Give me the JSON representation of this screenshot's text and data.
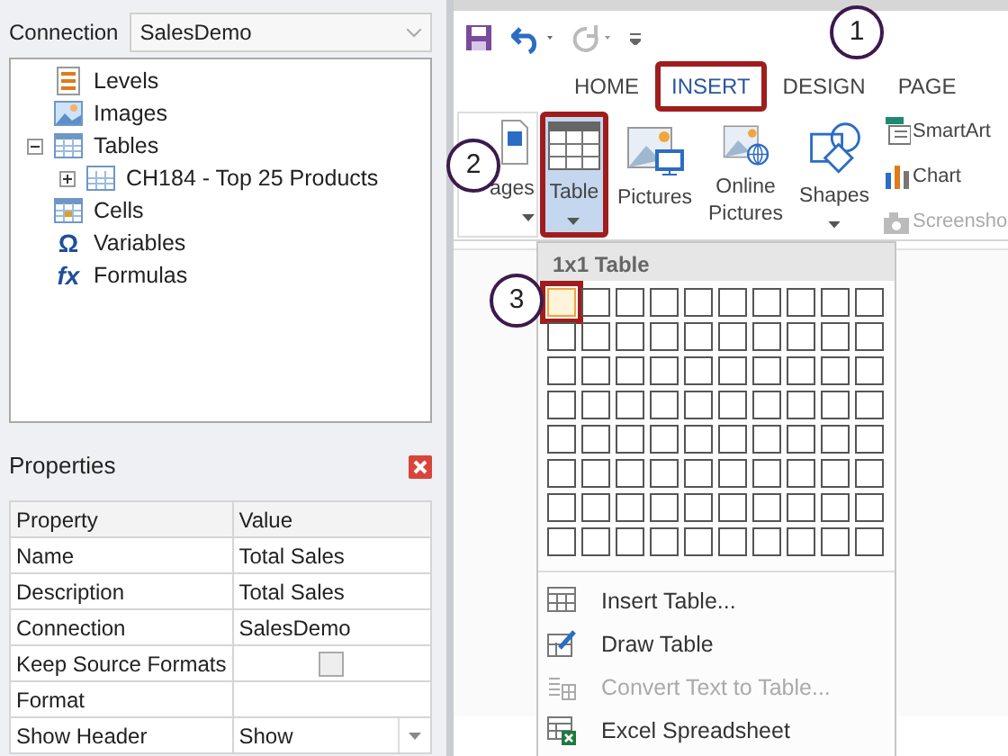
{
  "connection": {
    "label": "Connection",
    "value": "SalesDemo"
  },
  "tree": [
    {
      "label": "Levels",
      "kind": "levels"
    },
    {
      "label": "Images",
      "kind": "images"
    },
    {
      "label": "Tables",
      "kind": "tables",
      "expanded": true,
      "children": [
        {
          "label": "CH184 - Top 25 Products",
          "kind": "table",
          "expanded": false
        }
      ]
    },
    {
      "label": "Cells",
      "kind": "cells"
    },
    {
      "label": "Variables",
      "kind": "glyph",
      "glyph": "Ω"
    },
    {
      "label": "Formulas",
      "kind": "glyph",
      "glyph": "fx"
    }
  ],
  "properties": {
    "title": "Properties",
    "columns": [
      "Property",
      "Value"
    ],
    "rows": [
      {
        "name": "Name",
        "kind": "text",
        "value": "Total Sales"
      },
      {
        "name": "Description",
        "kind": "text",
        "value": "Total Sales"
      },
      {
        "name": "Connection",
        "kind": "text",
        "value": "SalesDemo"
      },
      {
        "name": "Keep Source Formats",
        "kind": "checkbox",
        "checked": false
      },
      {
        "name": "Format",
        "kind": "text"
      },
      {
        "name": "Show Header",
        "kind": "dropdown",
        "value": "Show"
      }
    ]
  },
  "ribbon_tabs": [
    {
      "label": "HOME",
      "selected": false,
      "highlighted": false
    },
    {
      "label": "INSERT",
      "selected": true,
      "highlighted": true
    },
    {
      "label": "DESIGN",
      "selected": false,
      "highlighted": false
    },
    {
      "label": "PAGE",
      "selected": false,
      "highlighted": false
    }
  ],
  "ribbon_buttons": [
    {
      "label": "ages",
      "kind": "pages",
      "selected": false,
      "highlighted": false
    },
    {
      "label": "Table",
      "kind": "table",
      "selected": true,
      "highlighted": true
    },
    {
      "label": "Pictures",
      "kind": "pictures",
      "selected": false,
      "highlighted": false
    },
    {
      "label": "Online\nPictures",
      "kind": "online",
      "selected": false,
      "highlighted": false
    },
    {
      "label": "Shapes",
      "kind": "shapes",
      "selected": false,
      "highlighted": false
    }
  ],
  "side_buttons": [
    {
      "label": "SmartArt",
      "kind": "smartart",
      "disabled": false
    },
    {
      "label": "Chart",
      "kind": "chart",
      "disabled": false
    },
    {
      "label": "Screensho",
      "kind": "screenshot",
      "disabled": true
    }
  ],
  "table_menu": {
    "header": "1x1 Table",
    "grid": [
      [
        true,
        false,
        false,
        false,
        false,
        false,
        false,
        false,
        false,
        false
      ],
      [
        false,
        false,
        false,
        false,
        false,
        false,
        false,
        false,
        false,
        false
      ],
      [
        false,
        false,
        false,
        false,
        false,
        false,
        false,
        false,
        false,
        false
      ],
      [
        false,
        false,
        false,
        false,
        false,
        false,
        false,
        false,
        false,
        false
      ],
      [
        false,
        false,
        false,
        false,
        false,
        false,
        false,
        false,
        false,
        false
      ],
      [
        false,
        false,
        false,
        false,
        false,
        false,
        false,
        false,
        false,
        false
      ],
      [
        false,
        false,
        false,
        false,
        false,
        false,
        false,
        false,
        false,
        false
      ],
      [
        false,
        false,
        false,
        false,
        false,
        false,
        false,
        false,
        false,
        false
      ]
    ],
    "items": [
      {
        "label": "Insert Table...",
        "kind": "insert",
        "disabled": false
      },
      {
        "label": "Draw Table",
        "kind": "draw",
        "disabled": false
      },
      {
        "label": "Convert Text to Table...",
        "kind": "convert",
        "disabled": true
      },
      {
        "label": "Excel Spreadsheet",
        "kind": "excel",
        "disabled": false
      }
    ]
  },
  "callouts": [
    {
      "number": "1"
    },
    {
      "number": "2"
    },
    {
      "number": "3"
    }
  ]
}
